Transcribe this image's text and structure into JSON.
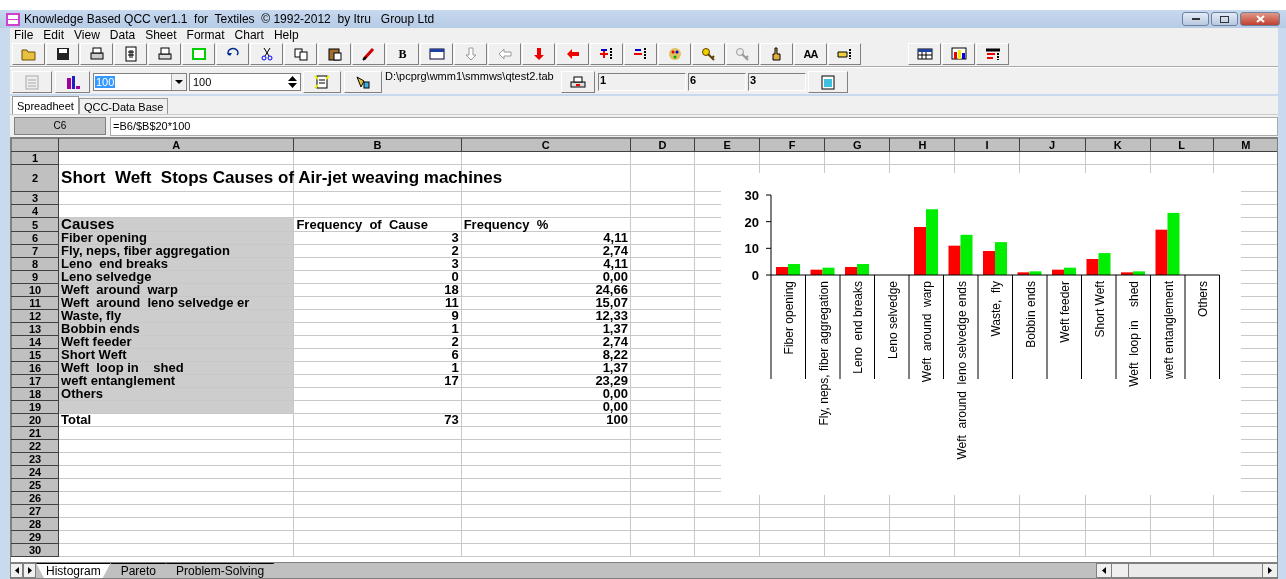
{
  "window": {
    "title": "Knowledge Based QCC ver1.1  for  Textiles  © 1992-2012  by Itru   Group Ltd"
  },
  "menu": [
    "File",
    "Edit",
    "View",
    "Data",
    "Sheet",
    "Format",
    "Chart",
    "Help"
  ],
  "toolbar_labels": {
    "bold": "B",
    "font": "AA"
  },
  "toolbar2": {
    "combo_value": "100",
    "combo_text_selected": true,
    "spin_value": "100",
    "file_path": "D:\\pcprg\\wmm1\\smmws\\qtest2.tab",
    "fields": [
      "1",
      "6",
      "3"
    ]
  },
  "tabs": [
    {
      "label": "Spreadheet",
      "selected": true
    },
    {
      "label": "QCC-Data Base",
      "selected": false
    }
  ],
  "formula_bar": {
    "cell": "C6",
    "formula": "=B6/$B$20*100"
  },
  "columns": [
    "A",
    "B",
    "C",
    "D",
    "E",
    "F",
    "G",
    "H",
    "I",
    "J",
    "K",
    "L",
    "M"
  ],
  "rows": [
    {
      "number": "1",
      "kind": "blank",
      "shaded": false
    },
    {
      "number": "2",
      "kind": "title",
      "shaded": false,
      "a": "Short  Weft  Stops Causes of Air-jet weaving machines"
    },
    {
      "number": "3",
      "kind": "blank",
      "shaded": false
    },
    {
      "number": "4",
      "kind": "blank",
      "shaded": false
    },
    {
      "number": "5",
      "kind": "header",
      "shaded": true,
      "a": "Causes",
      "b": "Frequency  of  Cause",
      "c": "Frequency  %"
    },
    {
      "number": "6",
      "kind": "data",
      "shaded": true,
      "a": "Fiber opening",
      "b": "3",
      "c": "4,11"
    },
    {
      "number": "7",
      "kind": "data",
      "shaded": true,
      "a": "Fly, neps, fiber aggregation",
      "b": "2",
      "c": "2,74"
    },
    {
      "number": "8",
      "kind": "data",
      "shaded": true,
      "a": "Leno  end breaks",
      "b": "3",
      "c": "4,11"
    },
    {
      "number": "9",
      "kind": "data",
      "shaded": true,
      "a": "Leno selvedge",
      "b": "0",
      "c": "0,00"
    },
    {
      "number": "10",
      "kind": "data",
      "shaded": true,
      "a": "Weft  around  warp",
      "b": "18",
      "c": "24,66"
    },
    {
      "number": "11",
      "kind": "data",
      "shaded": true,
      "a": "Weft  around  leno selvedge er",
      "b": "11",
      "c": "15,07"
    },
    {
      "number": "12",
      "kind": "data",
      "shaded": true,
      "a": "Waste, fly",
      "b": "9",
      "c": "12,33"
    },
    {
      "number": "13",
      "kind": "data",
      "shaded": true,
      "a": "Bobbin ends",
      "b": "1",
      "c": "1,37"
    },
    {
      "number": "14",
      "kind": "data",
      "shaded": true,
      "a": "Weft feeder",
      "b": "2",
      "c": "2,74"
    },
    {
      "number": "15",
      "kind": "data",
      "shaded": true,
      "a": "Short Weft",
      "b": "6",
      "c": "8,22"
    },
    {
      "number": "16",
      "kind": "data",
      "shaded": true,
      "a": "Weft  loop in    shed",
      "b": "1",
      "c": "1,37"
    },
    {
      "number": "17",
      "kind": "data",
      "shaded": true,
      "a": "weft entanglement",
      "b": "17",
      "c": "23,29"
    },
    {
      "number": "18",
      "kind": "data",
      "shaded": true,
      "a": "Others",
      "c": "0,00"
    },
    {
      "number": "19",
      "kind": "data",
      "shaded": true,
      "c": "0,00"
    },
    {
      "number": "20",
      "kind": "total",
      "shaded": false,
      "a": "Total",
      "b": "73",
      "c": "100"
    },
    {
      "number": "21",
      "kind": "blank",
      "shaded": false
    },
    {
      "number": "22",
      "kind": "blank",
      "shaded": false
    },
    {
      "number": "23",
      "kind": "blank",
      "shaded": false
    },
    {
      "number": "24",
      "kind": "blank",
      "shaded": false
    },
    {
      "number": "25",
      "kind": "blank",
      "shaded": false
    },
    {
      "number": "26",
      "kind": "blank",
      "shaded": false
    },
    {
      "number": "27",
      "kind": "blank",
      "shaded": false
    },
    {
      "number": "28",
      "kind": "blank",
      "shaded": false
    },
    {
      "number": "29",
      "kind": "blank",
      "shaded": false
    },
    {
      "number": "30",
      "kind": "blank",
      "shaded": false
    }
  ],
  "chart": {
    "chart_data": {
      "type": "bar",
      "categories": [
        "Fiber opening",
        "Fly, neps, fiber aggregation",
        "Leno  end breaks",
        "Leno selvedge",
        "Weft  around  warp",
        "Weft  around  leno selvedge ends",
        "Waste,  fly",
        "Bobbin ends",
        "Weft feeder",
        "Short Weft",
        "Weft  loop in    shed",
        "weft entanglement",
        "Others"
      ],
      "series": [
        {
          "color": "#ff0000",
          "values": [
            3,
            2,
            3,
            0,
            18,
            11,
            9,
            1,
            2,
            6,
            1,
            17,
            0
          ]
        },
        {
          "color": "#00ee00",
          "values": [
            4.11,
            2.74,
            4.11,
            0,
            24.66,
            15.07,
            12.33,
            1.37,
            2.74,
            8.22,
            1.37,
            23.29,
            0
          ]
        }
      ],
      "ylim": [
        0,
        30
      ],
      "yticks": [
        0,
        10,
        20,
        30
      ]
    }
  },
  "sheet_tabs": [
    {
      "label": "Histogram",
      "selected": true
    },
    {
      "label": "Pareto",
      "selected": false
    },
    {
      "label": "Problem-Solving",
      "selected": false
    }
  ]
}
